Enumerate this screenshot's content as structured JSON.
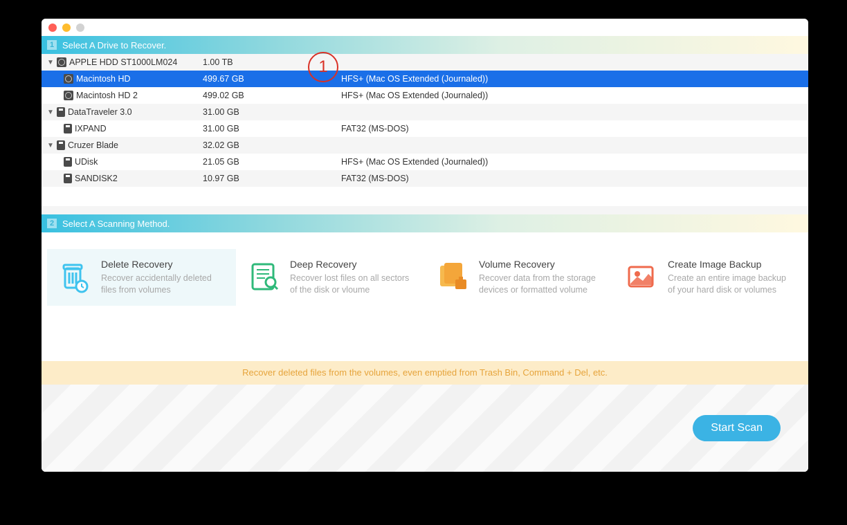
{
  "annotation": {
    "num": "1"
  },
  "section1": {
    "num": "1",
    "title": "Select A Drive to Recover."
  },
  "drives": [
    {
      "type": "parent",
      "icon": "hd",
      "name": "APPLE HDD ST1000LM024",
      "size": "1.00 TB",
      "fs": ""
    },
    {
      "type": "child",
      "icon": "hd",
      "name": "Macintosh HD",
      "size": "499.67 GB",
      "fs": "HFS+ (Mac OS Extended (Journaled))",
      "selected": true
    },
    {
      "type": "child",
      "icon": "hd",
      "name": "Macintosh HD 2",
      "size": "499.02 GB",
      "fs": "HFS+ (Mac OS Extended (Journaled))"
    },
    {
      "type": "parent",
      "icon": "usb",
      "name": "DataTraveler 3.0",
      "size": "31.00 GB",
      "fs": ""
    },
    {
      "type": "child",
      "icon": "usb",
      "name": "IXPAND",
      "size": "31.00 GB",
      "fs": "FAT32 (MS-DOS)"
    },
    {
      "type": "parent",
      "icon": "usb",
      "name": "Cruzer Blade",
      "size": "32.02 GB",
      "fs": ""
    },
    {
      "type": "child",
      "icon": "usb",
      "name": "UDisk",
      "size": "21.05 GB",
      "fs": "HFS+ (Mac OS Extended (Journaled))"
    },
    {
      "type": "child",
      "icon": "usb",
      "name": "SANDISK2",
      "size": "10.97 GB",
      "fs": "FAT32 (MS-DOS)"
    }
  ],
  "section2": {
    "num": "2",
    "title": "Select A Scanning Method."
  },
  "methods": [
    {
      "id": "delete",
      "title": "Delete Recovery",
      "desc": "Recover accidentally deleted files from volumes",
      "selected": true
    },
    {
      "id": "deep",
      "title": "Deep Recovery",
      "desc": "Recover lost files on all sectors of the disk or vloume"
    },
    {
      "id": "volume",
      "title": "Volume Recovery",
      "desc": "Recover data from the storage devices or formatted volume"
    },
    {
      "id": "backup",
      "title": "Create Image Backup",
      "desc": "Create an entire image backup of your hard disk or volumes"
    }
  ],
  "hint": "Recover deleted files from the volumes, even emptied from Trash Bin, Command + Del, etc.",
  "startScan": "Start Scan"
}
